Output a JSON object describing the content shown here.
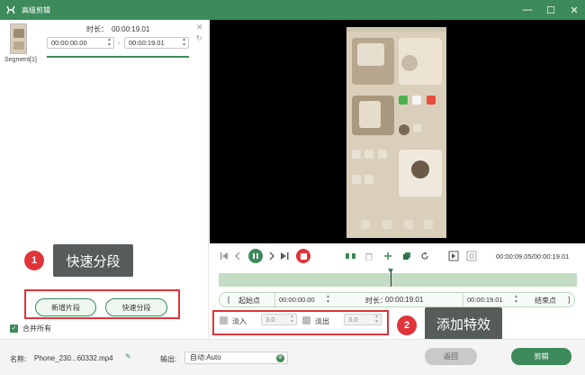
{
  "window": {
    "title": "高级剪辑",
    "controls": {
      "minimize": "—",
      "maximize": "☐",
      "close": "✕"
    }
  },
  "segment": {
    "label": "Segment[1]",
    "duration_label": "时长：",
    "duration_value": "00:00:19.01",
    "start_time": "00:00:00.00",
    "end_time": "00:00:19.01",
    "separator": "-"
  },
  "annotations": [
    {
      "number": "1",
      "text": "快速分段"
    },
    {
      "number": "2",
      "text": "添加特效"
    }
  ],
  "left_buttons": {
    "add_segment": "新增片段",
    "quick_split": "快速分段"
  },
  "merge_all": {
    "label": "合并所有",
    "checked": true
  },
  "player": {
    "timecode": "00:00:09.05/00:00:19.01"
  },
  "range": {
    "start_button": "起始点",
    "start_value": "00:00:00.00",
    "duration_label": "时长：",
    "duration_value": "00:00:19.01",
    "end_value": "00:00:19.01",
    "end_button": "结束点"
  },
  "effects": {
    "fade_in": {
      "label": "淡入",
      "value": "3.0",
      "checked": false
    },
    "fade_out": {
      "label": "淡出",
      "value": "3.0",
      "checked": false
    }
  },
  "footer": {
    "name_label": "名称:",
    "name_value": "Phone_230...60332.mp4",
    "output_label": "输出:",
    "output_value": "自动:Auto",
    "back_button": "返回",
    "clip_button": "剪辑"
  },
  "colors": {
    "accent": "#3d8a5a",
    "annotation_red": "#e0343a",
    "tooltip_bg": "#555c59"
  }
}
